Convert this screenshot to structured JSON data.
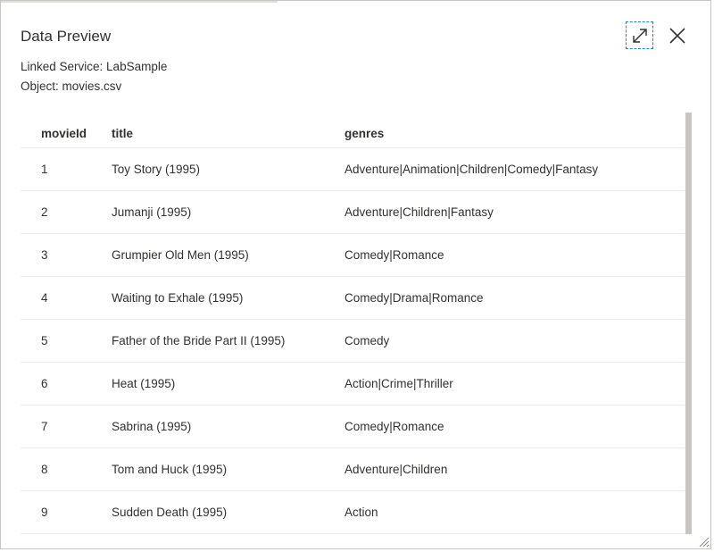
{
  "dialog": {
    "title": "Data Preview",
    "linked_service": "Linked Service: LabSample",
    "object": "Object: movies.csv"
  },
  "table": {
    "columns": [
      "movieId",
      "title",
      "genres"
    ],
    "rows": [
      [
        "1",
        "Toy Story (1995)",
        "Adventure|Animation|Children|Comedy|Fantasy"
      ],
      [
        "2",
        "Jumanji (1995)",
        "Adventure|Children|Fantasy"
      ],
      [
        "3",
        "Grumpier Old Men (1995)",
        "Comedy|Romance"
      ],
      [
        "4",
        "Waiting to Exhale (1995)",
        "Comedy|Drama|Romance"
      ],
      [
        "5",
        "Father of the Bride Part II (1995)",
        "Comedy"
      ],
      [
        "6",
        "Heat (1995)",
        "Action|Crime|Thriller"
      ],
      [
        "7",
        "Sabrina (1995)",
        "Comedy|Romance"
      ],
      [
        "8",
        "Tom and Huck (1995)",
        "Adventure|Children"
      ],
      [
        "9",
        "Sudden Death (1995)",
        "Action"
      ]
    ]
  },
  "icons": {
    "expand": "expand-icon",
    "close": "close-icon",
    "resize": "resize-grip-icon"
  },
  "colors": {
    "focus_outline": "#1a86d0",
    "text": "#323130",
    "row_divider": "#edebe9",
    "scrollbar": "#c8c6c4"
  }
}
